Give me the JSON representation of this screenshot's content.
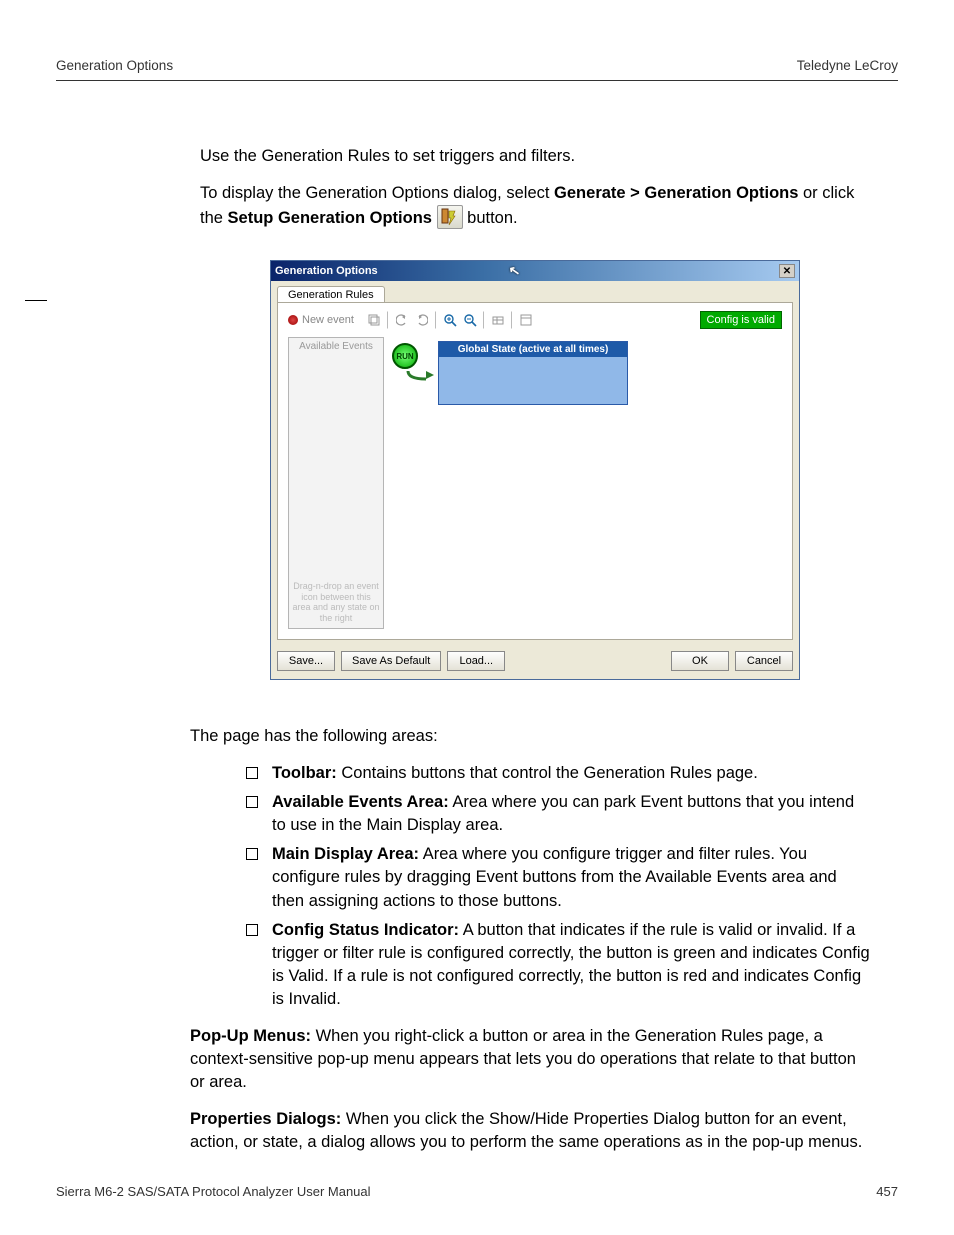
{
  "header": {
    "left": "Generation Options",
    "right": "Teledyne LeCroy"
  },
  "intro": {
    "p1": "Use the Generation Rules to set triggers and filters.",
    "p2a": "To display the Generation Options dialog, select ",
    "p2b": "Generate > Generation Options",
    "p2c": " or click the ",
    "p2d": "Setup Generation Options",
    "p2e": " button."
  },
  "dialog": {
    "title": "Generation Options",
    "tab": "Generation Rules",
    "new_event": "New event",
    "config_status": "Config is valid",
    "available_events_label": "Available Events",
    "hint": "Drag-n-drop an event icon between this area and any state on the right",
    "run_label": "RUN",
    "global_state_title": "Global State (active at all times)",
    "buttons": {
      "save": "Save...",
      "save_default": "Save As Default",
      "load": "Load...",
      "ok": "OK",
      "cancel": "Cancel"
    }
  },
  "areas_intro": "The page has the following areas:",
  "areas": {
    "toolbar_label": "Toolbar:",
    "toolbar_text": " Contains buttons that control the Generation Rules page.",
    "avail_label": "Available Events Area:",
    "avail_text": " Area where you can park Event buttons that you intend to use in the Main Display area.",
    "main_label": "Main Display Area:",
    "main_text": " Area where you configure trigger and filter rules. You configure rules by dragging Event buttons from the Available Events area and then assigning actions to those buttons.",
    "config_label": "Config Status Indicator:",
    "config_text": " A button that indicates if the rule is valid or invalid. If a trigger or filter rule is configured correctly, the button is green and indicates Config is Valid. If a rule is not configured correctly, the button is red and indicates Config is Invalid."
  },
  "popup": {
    "label": "Pop-Up Menus:",
    "text": " When you right-click a button or area in the Generation Rules page, a context-sensitive pop-up menu appears that lets you do operations that relate to that button or area."
  },
  "props": {
    "label": "Properties Dialogs:",
    "text": " When you click the Show/Hide Properties Dialog button for an event, action, or state, a dialog allows you to perform the same operations as in the pop-up menus."
  },
  "footer": {
    "left": "Sierra M6-2 SAS/SATA Protocol Analyzer User Manual",
    "right": "457"
  }
}
